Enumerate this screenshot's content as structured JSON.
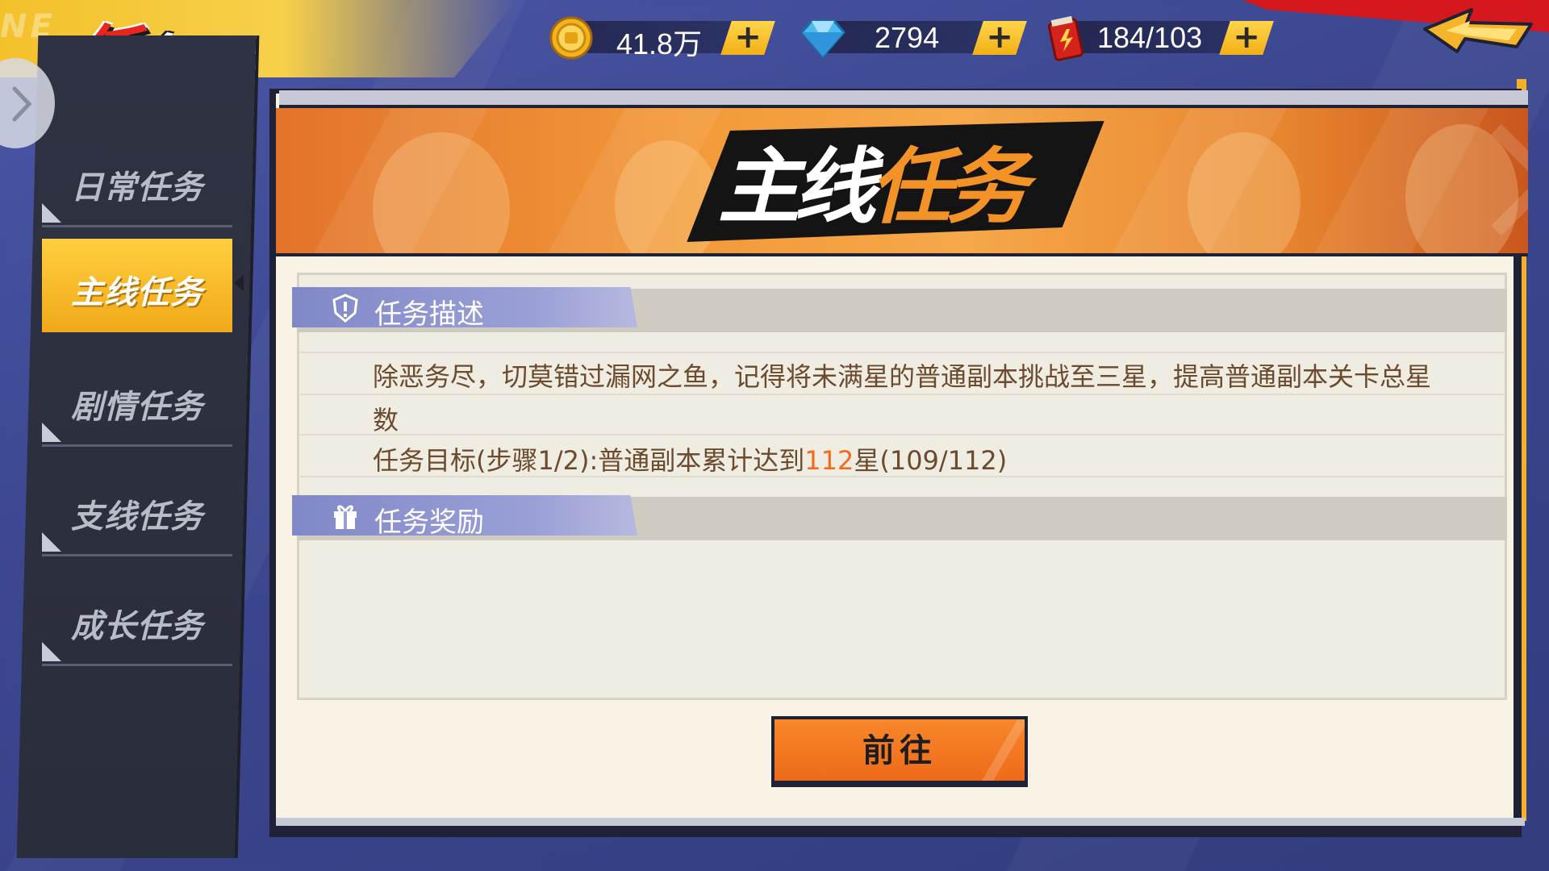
{
  "header": {
    "title_part1": "任",
    "title_part2": "务",
    "banner_text": "NE"
  },
  "currencies": [
    {
      "name": "gold-coin",
      "value": "41.8万",
      "icon": "coin-icon",
      "plus": "+"
    },
    {
      "name": "diamond",
      "value": "2794",
      "icon": "diamond-icon",
      "plus": "+"
    },
    {
      "name": "stamina",
      "value": "184/103",
      "icon": "energy-drink-icon",
      "plus": "+"
    }
  ],
  "sidebar": {
    "items": [
      {
        "label": "日常任务",
        "active": false
      },
      {
        "label": "主线任务",
        "active": true
      },
      {
        "label": "剧情任务",
        "active": false
      },
      {
        "label": "支线任务",
        "active": false
      },
      {
        "label": "成长任务",
        "active": false
      }
    ]
  },
  "banner": {
    "title_part1": "主线",
    "title_part2": "任务"
  },
  "task": {
    "description_header": "任务描述",
    "description": "除恶务尽，切莫错过漏网之鱼，记得将未满星的普通副本挑战至三星，提高普通副本关卡总星数",
    "goal_prefix": "任务目标(步骤1/2):普通副本累计达到",
    "goal_value": "112",
    "goal_suffix": "星(109/112)",
    "reward_header": "任务奖励"
  },
  "go_button": {
    "label": "前往"
  },
  "colors": {
    "accent_orange": "#f36a1f",
    "sidebar_active": "#f0a818",
    "text_brown": "#6b4a2e",
    "section_tag": "#8088c8"
  }
}
